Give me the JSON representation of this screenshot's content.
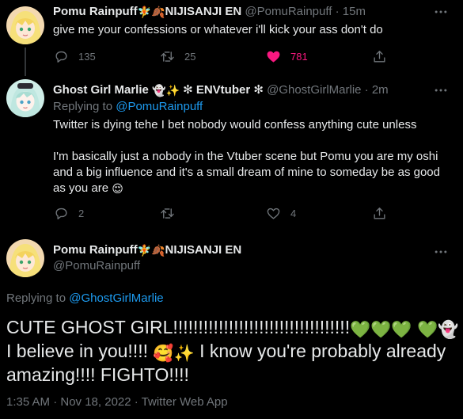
{
  "tweets": [
    {
      "name": "Pomu Rainpuff",
      "name_emoji": "🧚🍂",
      "name_suffix": "NIJISANJI EN",
      "handle": "@PomuRainpuff",
      "separator": "·",
      "time": "15m",
      "text": "give me your confessions or whatever i'll kick your ass don't do",
      "replies": "135",
      "retweets": "25",
      "likes": "781",
      "liked": true
    },
    {
      "name": "Ghost Girl Marlie",
      "name_emoji": "👻✨",
      "name_suffix": "✻ ENVtuber ✻",
      "handle": "@GhostGirlMarlie",
      "separator": "·",
      "time": "2m",
      "replying_prefix": "Replying to",
      "replying_to": "@PomuRainpuff",
      "text": "Twitter is dying tehe I bet nobody would confess anything cute unless\n\nI'm basically just a nobody in the Vtuber scene but Pomu you are my oshi and a big influence and it's a small dream of mine to someday be as good as you are",
      "text_emoji": "😌",
      "replies": "2",
      "retweets": "",
      "likes": "4"
    }
  ],
  "main_tweet": {
    "name": "Pomu Rainpuff",
    "name_emoji": "🧚🍂",
    "name_suffix": "NIJISANJI EN",
    "handle": "@PomuRainpuff",
    "replying_prefix": "Replying to",
    "replying_to": "@GhostGirlMarlie",
    "text_part1": "CUTE GHOST GIRL!!!!!!!!!!!!!!!!!!!!!!!!!!!!!!!!!!!",
    "emoji_hearts": "💚💚💚",
    "emoji_heart_ghost": "💚👻",
    "text_part2": "I believe in you!!!!",
    "emoji_love": "🥰✨",
    "text_part3": "I know you're probably already amazing!!!! FIGHTO!!!!",
    "timestamp": "1:35 AM · Nov 18, 2022 · Twitter Web App"
  },
  "colors": {
    "background": "#000000",
    "text": "#e7e9ea",
    "muted": "#71767b",
    "link": "#1d9bf0",
    "like": "#f91880"
  },
  "icons": [
    "reply-icon",
    "retweet-icon",
    "like-icon",
    "share-icon",
    "more-caret-icon"
  ]
}
